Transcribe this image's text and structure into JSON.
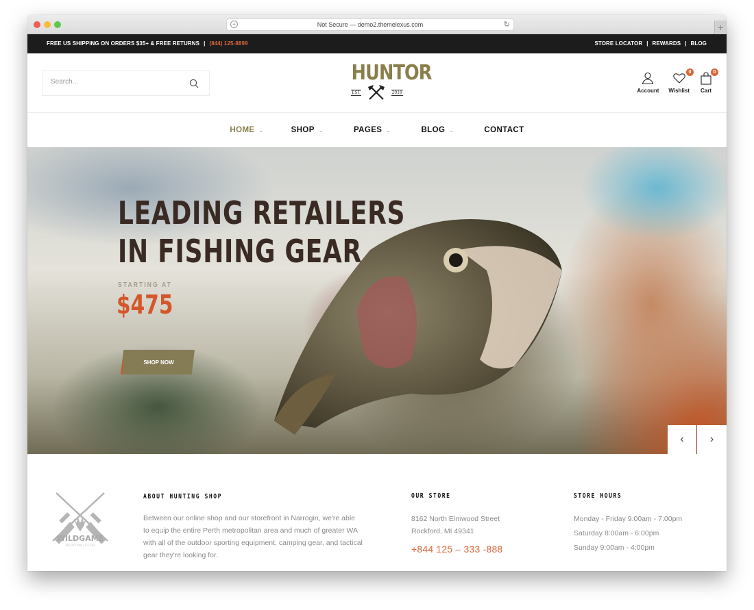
{
  "browser": {
    "url_text": "Not Secure — demo2.themelexus.com",
    "new_tab_label": "+"
  },
  "topbar": {
    "promo": "FREE US SHIPPING ON ORDERS $35+ & FREE RETURNS",
    "separator": "|",
    "phone": "(844) 125-8899",
    "links": [
      "STORE LOCATOR",
      "REWARDS",
      "BLOG"
    ]
  },
  "header": {
    "search_placeholder": "Search...",
    "logo_text": "HUNTOR",
    "logo_est": "EST",
    "logo_year": "2018",
    "account_label": "Account",
    "wishlist_label": "Wishlist",
    "wishlist_count": "0",
    "cart_label": "Cart",
    "cart_count": "0"
  },
  "nav": {
    "items": [
      {
        "label": "HOME",
        "chevron": "⌄"
      },
      {
        "label": "SHOP",
        "chevron": "⌄"
      },
      {
        "label": "PAGES",
        "chevron": "⌄"
      },
      {
        "label": "BLOG",
        "chevron": "⌄"
      },
      {
        "label": "CONTACT"
      }
    ]
  },
  "hero": {
    "title_line1": "LEADING RETAILERS",
    "title_line2": "IN FISHING GEAR",
    "subtitle": "STARTING AT",
    "price": "$475",
    "button_label": "SHOP NOW",
    "prev_arrow": "‹",
    "next_arrow": "›"
  },
  "info": {
    "logo_text": "WILDGAME",
    "logo_sub": "HUNTING CLUB",
    "about_title": "ABOUT HUNTING SHOP",
    "about_text": "Between our online shop and our storefront in Narrogin, we're able to equip the entire Perth metropolitan area and much of greater WA with all of the outdoor sporting equipment, camping gear, and tactical gear they're looking for.",
    "store_title": "OUR STORE",
    "store_address_line1": "8162 North Elmwood Street",
    "store_address_line2": "Rockford, MI 49341",
    "store_phone": "+844 125 – 333 -888",
    "hours_title": "STORE HOURS",
    "hours": [
      "Monday - Friday 9:00am - 7:00pm",
      "Saturday 8:00am - 6:00pm",
      "Sunday 9:00am - 4:00pm"
    ]
  },
  "colors": {
    "accent_orange": "#d9673a",
    "brand_olive": "#8a7f4c",
    "topbar_bg": "#1c1c1c"
  }
}
